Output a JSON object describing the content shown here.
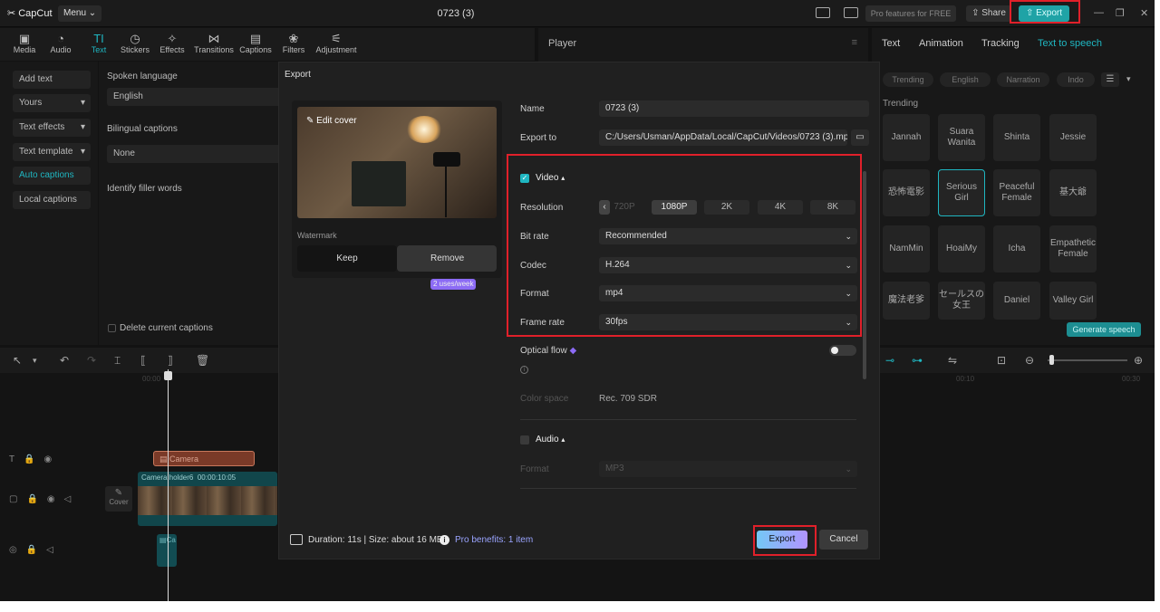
{
  "app": {
    "logo": "CapCut",
    "menu_label": "Menu",
    "project_title": "0723 (3)",
    "pro_features_label": "Pro features for FREE",
    "share_label": "Share",
    "export_label": "Export"
  },
  "toolbar": {
    "tools": [
      "Media",
      "Audio",
      "Text",
      "Stickers",
      "Effects",
      "Transitions",
      "Captions",
      "Filters",
      "Adjustment"
    ]
  },
  "sidebar": {
    "items": [
      "Add text",
      "Yours",
      "Text effects",
      "Text template",
      "Auto captions",
      "Local captions"
    ]
  },
  "captions_panel": {
    "spoken_language_label": "Spoken language",
    "spoken_language_value": "English",
    "bilingual_label": "Bilingual captions",
    "bilingual_value": "None",
    "filler_label": "Identify filler words",
    "delete_label": "Delete current captions"
  },
  "player": {
    "title": "Player"
  },
  "right_panel": {
    "tabs": [
      "Text",
      "Animation",
      "Tracking",
      "Text to speech"
    ],
    "chips": [
      "Trending",
      "English",
      "Narration",
      "Indo"
    ],
    "section_label": "Trending",
    "voices": [
      "Jannah",
      "Suara Wanita",
      "Shinta",
      "Jessie",
      "恐怖電影",
      "Serious Girl",
      "Peaceful Female",
      "基大爺",
      "NamMin",
      "HoaiMy",
      "Icha",
      "Empathetic Female",
      "魔法老爹",
      "セールスの女王",
      "Daniel",
      "Valley Girl"
    ],
    "generate_label": "Generate speech"
  },
  "timeline": {
    "time_start": "00:00",
    "time_mid": "00:10",
    "time_end": "00:30",
    "text_clip_label": "Camera",
    "video_clip_label": "Camera holder6",
    "video_clip_duration": "00:00:10:05",
    "cover_label": "Cover",
    "audio_clip_label": "Ca"
  },
  "export_dialog": {
    "title": "Export",
    "edit_cover_label": "Edit cover",
    "watermark_label": "Watermark",
    "keep_label": "Keep",
    "remove_label": "Remove",
    "remove_badge": "2 uses/week",
    "name_label": "Name",
    "name_value": "0723 (3)",
    "export_to_label": "Export to",
    "export_to_value": "C:/Users/Usman/AppData/Local/CapCut/Videos/0723 (3).mp4",
    "video_section_label": "Video",
    "resolution_label": "Resolution",
    "resolution_options": [
      "720P",
      "1080P",
      "2K",
      "4K",
      "8K"
    ],
    "bitrate_label": "Bit rate",
    "bitrate_value": "Recommended",
    "codec_label": "Codec",
    "codec_value": "H.264",
    "format_label": "Format",
    "format_value": "mp4",
    "framerate_label": "Frame rate",
    "framerate_value": "30fps",
    "optical_flow_label": "Optical flow",
    "color_space_label": "Color space",
    "color_space_value": "Rec. 709 SDR",
    "audio_section_label": "Audio",
    "audio_format_label": "Format",
    "audio_format_value": "MP3",
    "footer_info": "Duration: 11s | Size: about 16 MB",
    "pro_benefits": "Pro benefits: 1 item",
    "export_button": "Export",
    "cancel_button": "Cancel"
  },
  "colors": {
    "accent_teal": "#1fb6c1",
    "highlight_red": "#e0202a",
    "pro_purple": "#8c6bf5"
  }
}
